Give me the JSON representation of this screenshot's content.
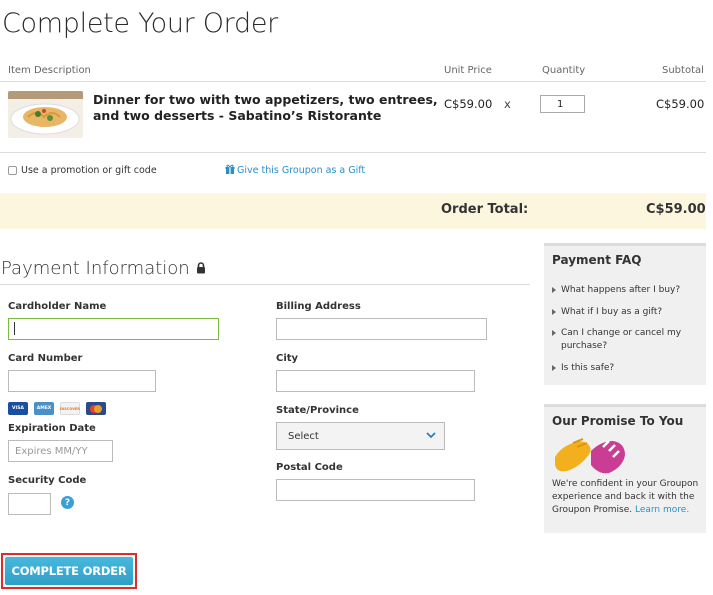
{
  "page": {
    "title": "Complete Your Order"
  },
  "cart": {
    "columns": {
      "item_description": "Item Description",
      "unit_price": "Unit Price",
      "quantity": "Quantity",
      "subtotal": "Subtotal"
    },
    "item": {
      "description": "Dinner for two with two appetizers, two entrees, and two desserts - Sabatino’s Ristorante",
      "unit_price": "C$59.00",
      "times": "x",
      "quantity": "1",
      "subtotal": "C$59.00"
    },
    "promo_label": "Use a promotion or gift code",
    "gift_link": "Give this Groupon as a Gift",
    "order_total_label": "Order Total:",
    "order_total_value": "C$59.00"
  },
  "payment": {
    "title": "Payment Information",
    "cardholder_label": "Cardholder Name",
    "card_number_label": "Card Number",
    "expiration_label": "Expiration Date",
    "expiration_placeholder": "Expires MM/YY",
    "security_label": "Security Code",
    "billing_label": "Billing Address",
    "city_label": "City",
    "state_label": "State/Province",
    "state_selected": "Select",
    "postal_label": "Postal Code",
    "card_logos": [
      "VISA",
      "AMEX",
      "DISCOVER",
      "MC"
    ],
    "complete_button": "COMPLETE ORDER"
  },
  "faq": {
    "title": "Payment FAQ",
    "items": [
      "What happens after I buy?",
      "What if I buy as a gift?",
      "Can I change or cancel my purchase?",
      "Is this safe?"
    ]
  },
  "promise": {
    "title": "Our Promise To You",
    "text": "We're confident in your Groupon experience and back it with the Groupon Promise.",
    "learn_more": "Learn more."
  },
  "colors": {
    "accent_blue": "#2a8fc9",
    "button_blue": "#3aa8d2",
    "total_bar": "#fcf6df",
    "active_field_border": "#7dbb3f",
    "highlight_red": "#e02b2b"
  }
}
